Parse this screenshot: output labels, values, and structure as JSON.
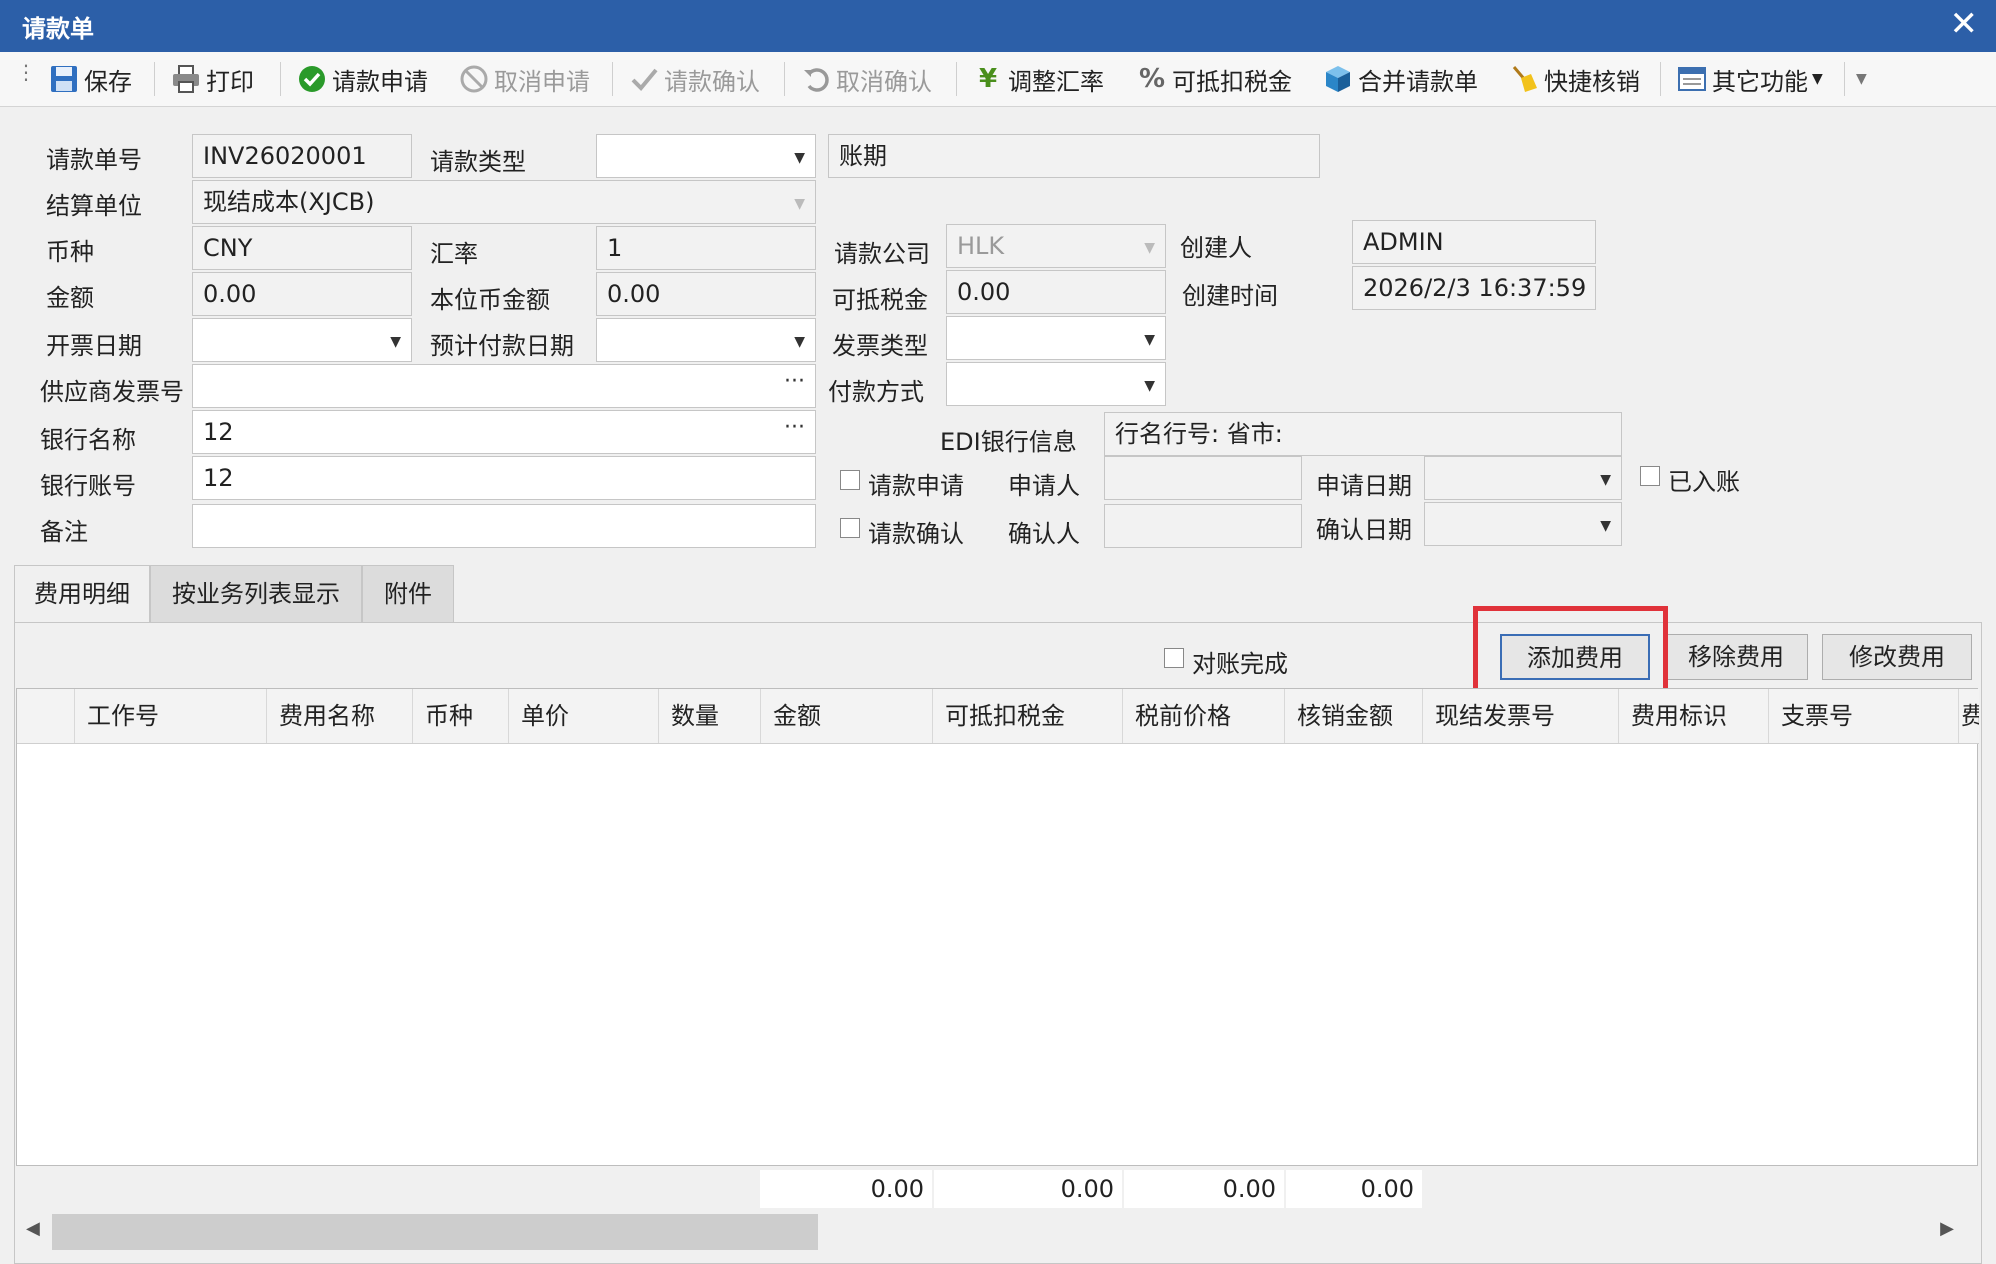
{
  "window": {
    "title": "请款单",
    "close_glyph": "✕"
  },
  "toolbar": {
    "save": "保存",
    "print": "打印",
    "apply": "请款申请",
    "cancel_apply": "取消申请",
    "confirm": "请款确认",
    "cancel_confirm": "取消确认",
    "adjust_rate": "调整汇率",
    "deductible_tax": "可抵扣税金",
    "merge": "合并请款单",
    "quick_writeoff": "快捷核销",
    "other": "其它功能"
  },
  "form": {
    "invoice_no_label": "请款单号",
    "invoice_no": "INV26020001",
    "type_label": "请款类型",
    "type_value": "",
    "term": "账期",
    "settle_unit_label": "结算单位",
    "settle_unit": "现结成本(XJCB)",
    "currency_label": "币种",
    "currency": "CNY",
    "rate_label": "汇率",
    "rate": "1",
    "company_label": "请款公司",
    "company": "HLK",
    "creator_label": "创建人",
    "creator": "ADMIN",
    "amount_label": "金额",
    "amount": "0.00",
    "local_amount_label": "本位币金额",
    "local_amount": "0.00",
    "deduct_tax_label": "可抵税金",
    "deduct_tax": "0.00",
    "created_time_label": "创建时间",
    "created_time": "2026/2/3 16:37:59",
    "invoice_date_label": "开票日期",
    "expected_pay_label": "预计付款日期",
    "invoice_type_label": "发票类型",
    "supplier_invoice_label": "供应商发票号",
    "pay_method_label": "付款方式",
    "bank_name_label": "银行名称",
    "bank_name": "12",
    "edi_label": "EDI银行信息",
    "edi_value": "行名行号:   省市:",
    "bank_account_label": "银行账号",
    "bank_account": "12",
    "apply_check_label": "请款申请",
    "applicant_label": "申请人",
    "apply_date_label": "申请日期",
    "posted_label": "已入账",
    "remark_label": "备注",
    "confirm_check_label": "请款确认",
    "confirmer_label": "确认人",
    "confirm_date_label": "确认日期"
  },
  "tabs": [
    "费用明细",
    "按业务列表显示",
    "附件"
  ],
  "actions": {
    "reconciled": "对账完成",
    "add": "添加费用",
    "remove": "移除费用",
    "edit": "修改费用"
  },
  "grid": {
    "columns": [
      "工作号",
      "费用名称",
      "币种",
      "单价",
      "数量",
      "金额",
      "可抵扣税金",
      "税前价格",
      "核销金额",
      "现结发票号",
      "费用标识",
      "支票号",
      "费"
    ],
    "totals": [
      "0.00",
      "0.00",
      "0.00",
      "0.00"
    ]
  }
}
